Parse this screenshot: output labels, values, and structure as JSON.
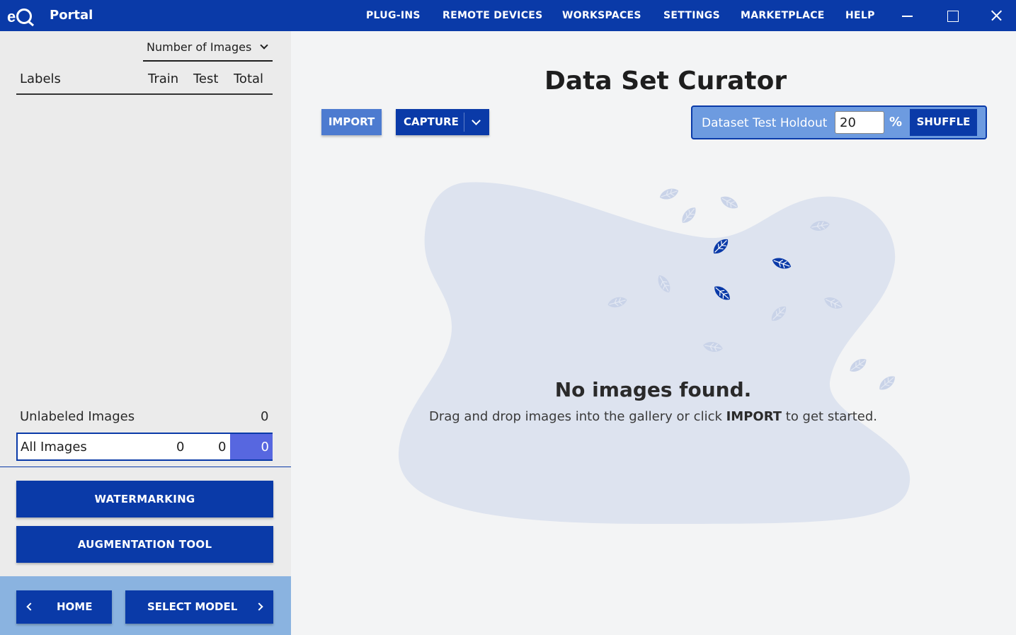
{
  "titlebar": {
    "logo": "eIQ",
    "app_name": "Portal",
    "nav": [
      "PLUG-INS",
      "REMOTE DEVICES",
      "WORKSPACES",
      "SETTINGS",
      "MARKETPLACE",
      "HELP"
    ]
  },
  "sidebar": {
    "metric_select": "Number of Images",
    "columns": {
      "labels": "Labels",
      "train": "Train",
      "test": "Test",
      "total": "Total"
    },
    "unlabeled": {
      "label": "Unlabeled Images",
      "count": "0"
    },
    "all_images": {
      "label": "All Images",
      "train": "0",
      "test": "0",
      "total": "0"
    },
    "tools": {
      "watermarking": "WATERMARKING",
      "augmentation": "AUGMENTATION TOOL"
    },
    "footer": {
      "home": "HOME",
      "select_model": "SELECT MODEL"
    }
  },
  "main": {
    "title": "Data Set Curator",
    "import_label": "IMPORT",
    "capture_label": "CAPTURE",
    "holdout": {
      "label": "Dataset Test Holdout",
      "value": "20",
      "unit": "%",
      "shuffle_label": "SHUFFLE"
    },
    "empty": {
      "title": "No images found.",
      "msg_before": "Drag and drop images into the gallery or click ",
      "msg_bold": "IMPORT",
      "msg_after": " to get started."
    }
  },
  "colors": {
    "primary": "#0a3aa8",
    "accent": "#5767e0",
    "blob": "#dde3ef",
    "leaf_light": "#c9d3e8",
    "leaf_dark": "#0a3aa8"
  },
  "icons": [
    "minimize-icon",
    "maximize-icon",
    "close-icon",
    "chevron-down-icon",
    "chevron-left-icon",
    "chevron-right-icon",
    "leaf-icon"
  ]
}
